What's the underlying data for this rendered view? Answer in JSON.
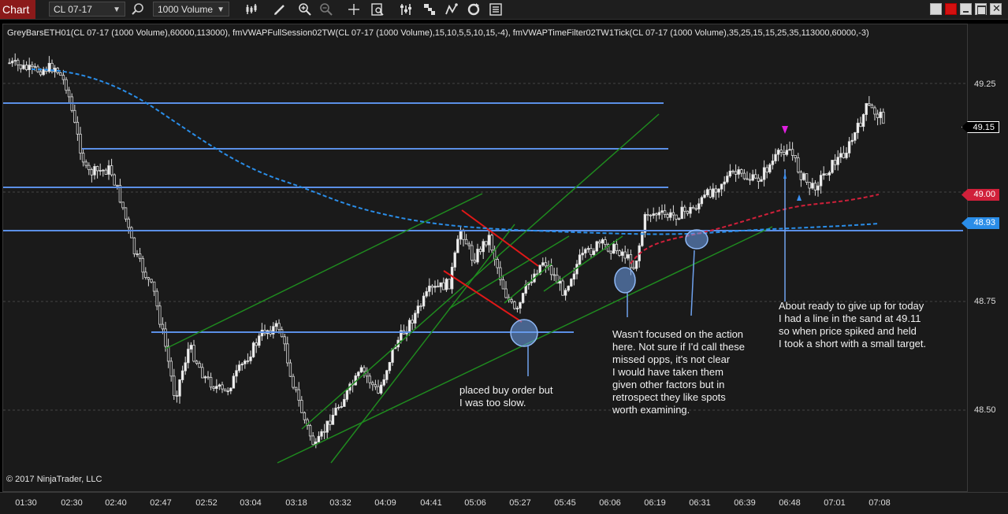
{
  "toolbar": {
    "chart_tab": "Chart",
    "instrument": "CL 07-17",
    "interval": "1000 Volume"
  },
  "indicator_line": "GreyBarsETH01(CL 07-17 (1000 Volume),60000,113000), fmVWAPFullSession02TW(CL 07-17 (1000 Volume),15,10,5,5,10,15,-4), fmVWAPTimeFilter02TW1Tick(CL 07-17 (1000 Volume),35,25,15,15,25,35,113000,60000,-3)",
  "copyright": "© 2017 NinjaTrader, LLC",
  "price_axis": {
    "ticks": [
      "49.25",
      "48.75",
      "48.50"
    ],
    "labels": [
      {
        "text": "49.15",
        "color": "#000000",
        "border": "#ffffff"
      },
      {
        "text": "49.00",
        "color": "#d0203a",
        "border": "#d0203a"
      },
      {
        "text": "48.93",
        "color": "#2a8de8",
        "border": "#2a8de8"
      }
    ]
  },
  "time_axis": [
    "01:30",
    "02:30",
    "02:40",
    "02:47",
    "02:52",
    "03:04",
    "03:18",
    "03:32",
    "04:09",
    "04:41",
    "05:06",
    "05:27",
    "05:45",
    "06:06",
    "06:19",
    "06:31",
    "06:39",
    "06:48",
    "07:01",
    "07:08"
  ],
  "annotations": {
    "buy_order": "placed buy order but\nI was too slow.",
    "missed_opps": "Wasn't focused on the action\nhere. Not sure if I'd call these\nmissed opps, it's not clear\nI would have taken them\ngiven other factors but in\nretrospect they like spots\nworth examining.",
    "short_trade": "About ready to give up for today\nI had a line in the sand at 49.11\nso when price spiked and held\nI took a short with a small target."
  },
  "colors": {
    "horizontal_lines": "#5b8fe6",
    "trend_lines": "#1f8a1f",
    "red_lines": "#e01818",
    "vwap_full": "#2a8de8",
    "vwap_filter": "#d0203a",
    "markers": "#6fa2ee"
  },
  "icons": [
    "crosshair-icon",
    "bar-style-icon",
    "draw-icon",
    "zoom-in-icon",
    "zoom-out-icon",
    "cross-icon",
    "data-box-icon",
    "indicators-icon",
    "strategies-icon",
    "chart-trader-icon",
    "refresh-icon",
    "properties-icon"
  ]
}
